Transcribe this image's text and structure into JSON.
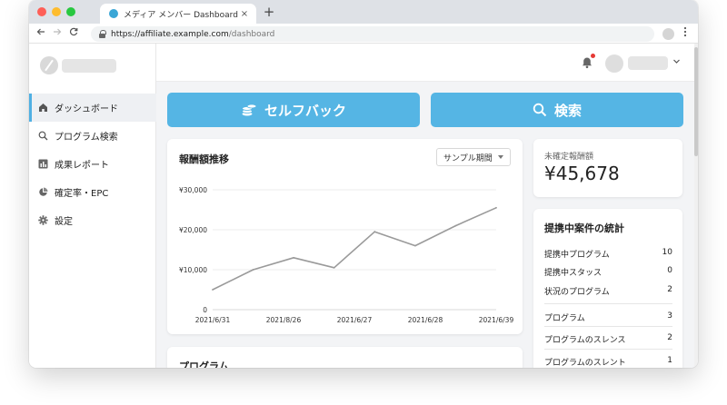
{
  "browser": {
    "tab_title": "メディア メンバー Dashboard",
    "tab_close": "×",
    "new_tab": "+",
    "url_host": "https://affiliate.example.com",
    "url_path": "/dashboard",
    "traffic_lights": [
      "#fe5f57",
      "#febc2e",
      "#28c840"
    ]
  },
  "sidebar": {
    "items": [
      {
        "label": "ダッシュボード",
        "icon": "home-icon",
        "active": true
      },
      {
        "label": "プログラム検索",
        "icon": "search-icon",
        "active": false
      },
      {
        "label": "成果レポート",
        "icon": "bar-chart-icon",
        "active": false
      },
      {
        "label": "確定率・EPC",
        "icon": "pie-chart-icon",
        "active": false
      },
      {
        "label": "設定",
        "icon": "gear-icon",
        "active": false
      }
    ]
  },
  "actions": {
    "selfback_label": "セルフバック",
    "search_label": "検索"
  },
  "revenue_card": {
    "title": "報酬額推移",
    "period_label": "サンプル期間"
  },
  "unconfirmed": {
    "label": "未確定報酬額",
    "value": "¥45,678"
  },
  "stats": {
    "title": "提携中案件の統計",
    "rows": [
      {
        "label": "提携中プログラム",
        "value": "10"
      },
      {
        "label": "提携中スタッス",
        "value": "0"
      },
      {
        "label": "状況のプログラム",
        "value": "2"
      },
      {
        "label": "プログラム",
        "value": "3"
      },
      {
        "label": "プログラムのスレンス",
        "value": "2"
      },
      {
        "label": "プログラムのスレント",
        "value": "1"
      }
    ]
  },
  "programs_card": {
    "title": "プログラム"
  },
  "colors": {
    "accent": "#55b5e4",
    "line": "#9a9a9a",
    "sidebar_active": "#4fb0e3"
  },
  "chart_data": {
    "type": "line",
    "title": "報酬額推移",
    "x": [
      "",
      "",
      "",
      "",
      "",
      "",
      "",
      ""
    ],
    "x_tick_labels": [
      "2021/6/31",
      "2021/8/26",
      "2021/6/27",
      "2021/6/28",
      "2021/6/39"
    ],
    "y_tick_labels": [
      "0",
      "¥10,000",
      "¥20,000",
      "¥30,000"
    ],
    "ylim": [
      0,
      30000
    ],
    "series": [
      {
        "values": [
          5000,
          10000,
          13000,
          10500,
          19500,
          16000,
          21000,
          25500
        ]
      }
    ],
    "grid": true
  }
}
